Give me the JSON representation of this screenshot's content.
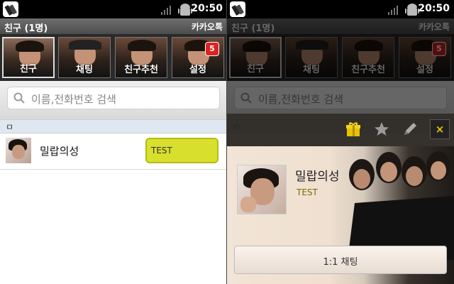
{
  "status_bar": {
    "time": "20:50"
  },
  "title_bar": {
    "title": "친구 (1명)",
    "app_name": "카카오톡"
  },
  "tabs": [
    {
      "label": "친구",
      "selected": true
    },
    {
      "label": "채팅",
      "selected": false
    },
    {
      "label": "친구추천",
      "selected": false
    },
    {
      "label": "설정",
      "selected": false,
      "badge": "5"
    }
  ],
  "search": {
    "placeholder": "이름,전화번호 검색"
  },
  "section": {
    "letter": "ㅁ"
  },
  "friend": {
    "name": "밀랍의성",
    "status_message": "TEST"
  },
  "profile_popup": {
    "name": "밀랍의성",
    "status_message": "TEST",
    "chat_button": "1:1 채팅",
    "actions": [
      "gift-icon",
      "star-icon",
      "pencil-icon",
      "close-icon"
    ],
    "close_symbol": "×"
  },
  "colors": {
    "status_bubble": "#d8df2c",
    "badge": "#dd2222",
    "close_accent": "#e6c700"
  }
}
